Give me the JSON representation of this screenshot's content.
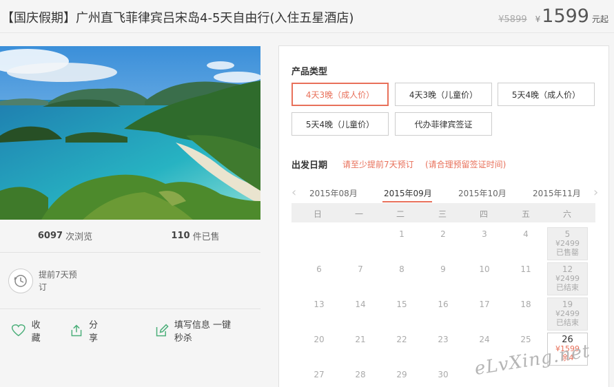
{
  "header": {
    "title": "【国庆假期】广州直飞菲律宾吕宋岛4-5天自由行(入住五星酒店)",
    "old_price": "¥5899",
    "currency": "¥",
    "price": "1599",
    "unit": "元起"
  },
  "stats": {
    "views": "6097",
    "views_label": "次浏览",
    "sold": "110",
    "sold_label": "件已售"
  },
  "advance": {
    "text": "提前7天预订"
  },
  "actions": {
    "favorite": "收藏",
    "share": "分享",
    "fill": "填写信息 一键秒杀"
  },
  "product": {
    "label": "产品类型",
    "options": [
      "4天3晚（成人价）",
      "4天3晚（儿童价）",
      "5天4晚（成人价）",
      "5天4晚（儿童价）",
      "代办菲律宾签证"
    ],
    "selected_index": 0
  },
  "departure": {
    "label": "出发日期",
    "notice1": "请至少提前7天预订",
    "notice2": "(请合理预留签证时间)"
  },
  "calendar": {
    "months": [
      "2015年08月",
      "2015年09月",
      "2015年10月",
      "2015年11月"
    ],
    "active_month": "2015年09月",
    "weekdays": [
      "日",
      "一",
      "二",
      "三",
      "四",
      "五",
      "六"
    ],
    "cells": [
      {
        "day": "5",
        "price": "¥2499",
        "status": "已售罄"
      },
      {
        "day": "12",
        "price": "¥2499",
        "status": "已结束"
      },
      {
        "day": "19",
        "price": "¥2499",
        "status": "已结束"
      },
      {
        "day": "26",
        "price": "¥1599",
        "status": "余4"
      }
    ]
  },
  "watermark": "eLvXing.net",
  "colors": {
    "accent": "#e8705a",
    "green_icon": "#4caf7a"
  }
}
